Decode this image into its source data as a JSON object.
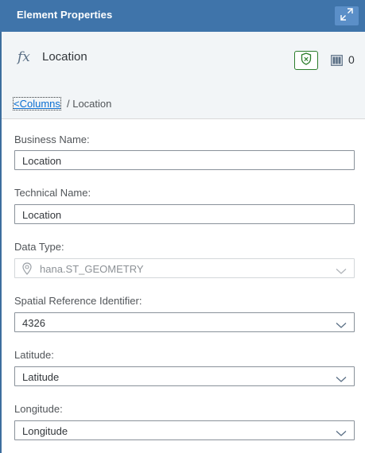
{
  "panel": {
    "title": "Element Properties"
  },
  "element": {
    "name": "Location",
    "column_count": "0"
  },
  "breadcrumb": {
    "link_label": "<Columns",
    "current": " / Location"
  },
  "form": {
    "business_name": {
      "label": "Business Name:",
      "value": "Location"
    },
    "technical_name": {
      "label": "Technical Name:",
      "value": "Location"
    },
    "data_type": {
      "label": "Data Type:",
      "value": "hana.ST_GEOMETRY"
    },
    "srid": {
      "label": "Spatial Reference Identifier:",
      "value": "4326"
    },
    "latitude": {
      "label": "Latitude:",
      "value": "Latitude"
    },
    "longitude": {
      "label": "Longitude:",
      "value": "Longitude"
    }
  },
  "icons": {
    "expand": "expand-icon",
    "function": "fx-icon",
    "shield": "shield-icon",
    "columns": "columns-icon",
    "chevron": "chevron-down-icon",
    "location_pin": "location-pin-icon"
  },
  "colors": {
    "header_bg": "#3f74aa",
    "link": "#0a6ed1",
    "shield_border": "#2b7d2b"
  }
}
